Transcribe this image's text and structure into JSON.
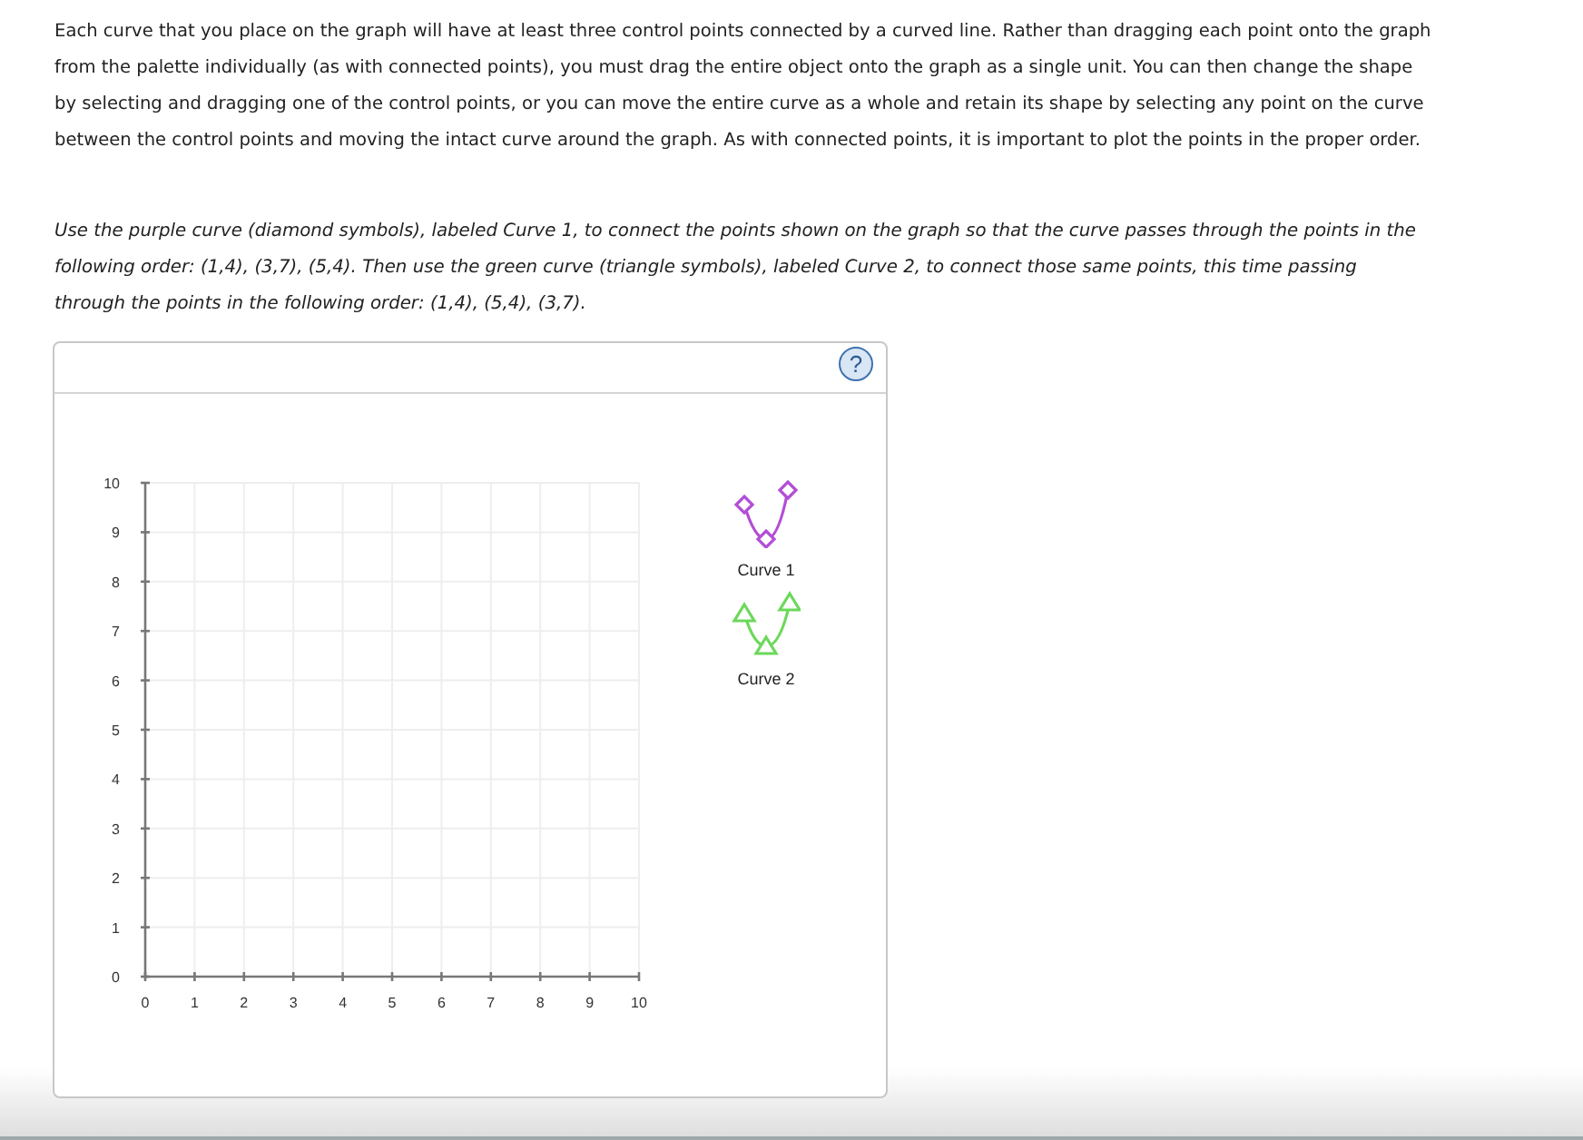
{
  "instructions": "Each curve that you place on the graph will have at least three control points connected by a curved line. Rather than dragging each point onto the graph from the palette individually (as with connected points), you must drag the entire object onto the graph as a single unit. You can then change the shape by selecting and dragging one of the control points, or you can move the entire curve as a whole and retain its shape by selecting any point on the curve between the control points and moving the intact curve around the graph. As with connected points, it is important to plot the points in the proper order.",
  "task": "Use the purple curve (diamond symbols), labeled Curve 1, to connect the points shown on the graph so that the curve passes through the points in the following order: (1,4), (3,7), (5,4). Then use the green curve (triangle symbols), labeled Curve 2, to connect those same points, this time passing through the points in the following order: (1,4), (5,4), (3,7).",
  "graph_panel": {
    "help_button": {
      "label": "?"
    },
    "graph": {
      "chart_data": {
        "type": "scatter",
        "grid": true,
        "xlim": [
          0,
          10
        ],
        "ylim": [
          0,
          10
        ],
        "xticks": [
          0,
          1,
          2,
          3,
          4,
          5,
          6,
          7,
          8,
          9,
          10
        ],
        "yticks": [
          0,
          1,
          2,
          3,
          4,
          5,
          6,
          7,
          8,
          9,
          10
        ]
      }
    },
    "palette": [
      {
        "label": "Curve 1",
        "kind": "diamond",
        "color": "#b34ed6"
      },
      {
        "label": "Curve 2",
        "kind": "triangle",
        "color": "#6cd85a"
      }
    ]
  }
}
